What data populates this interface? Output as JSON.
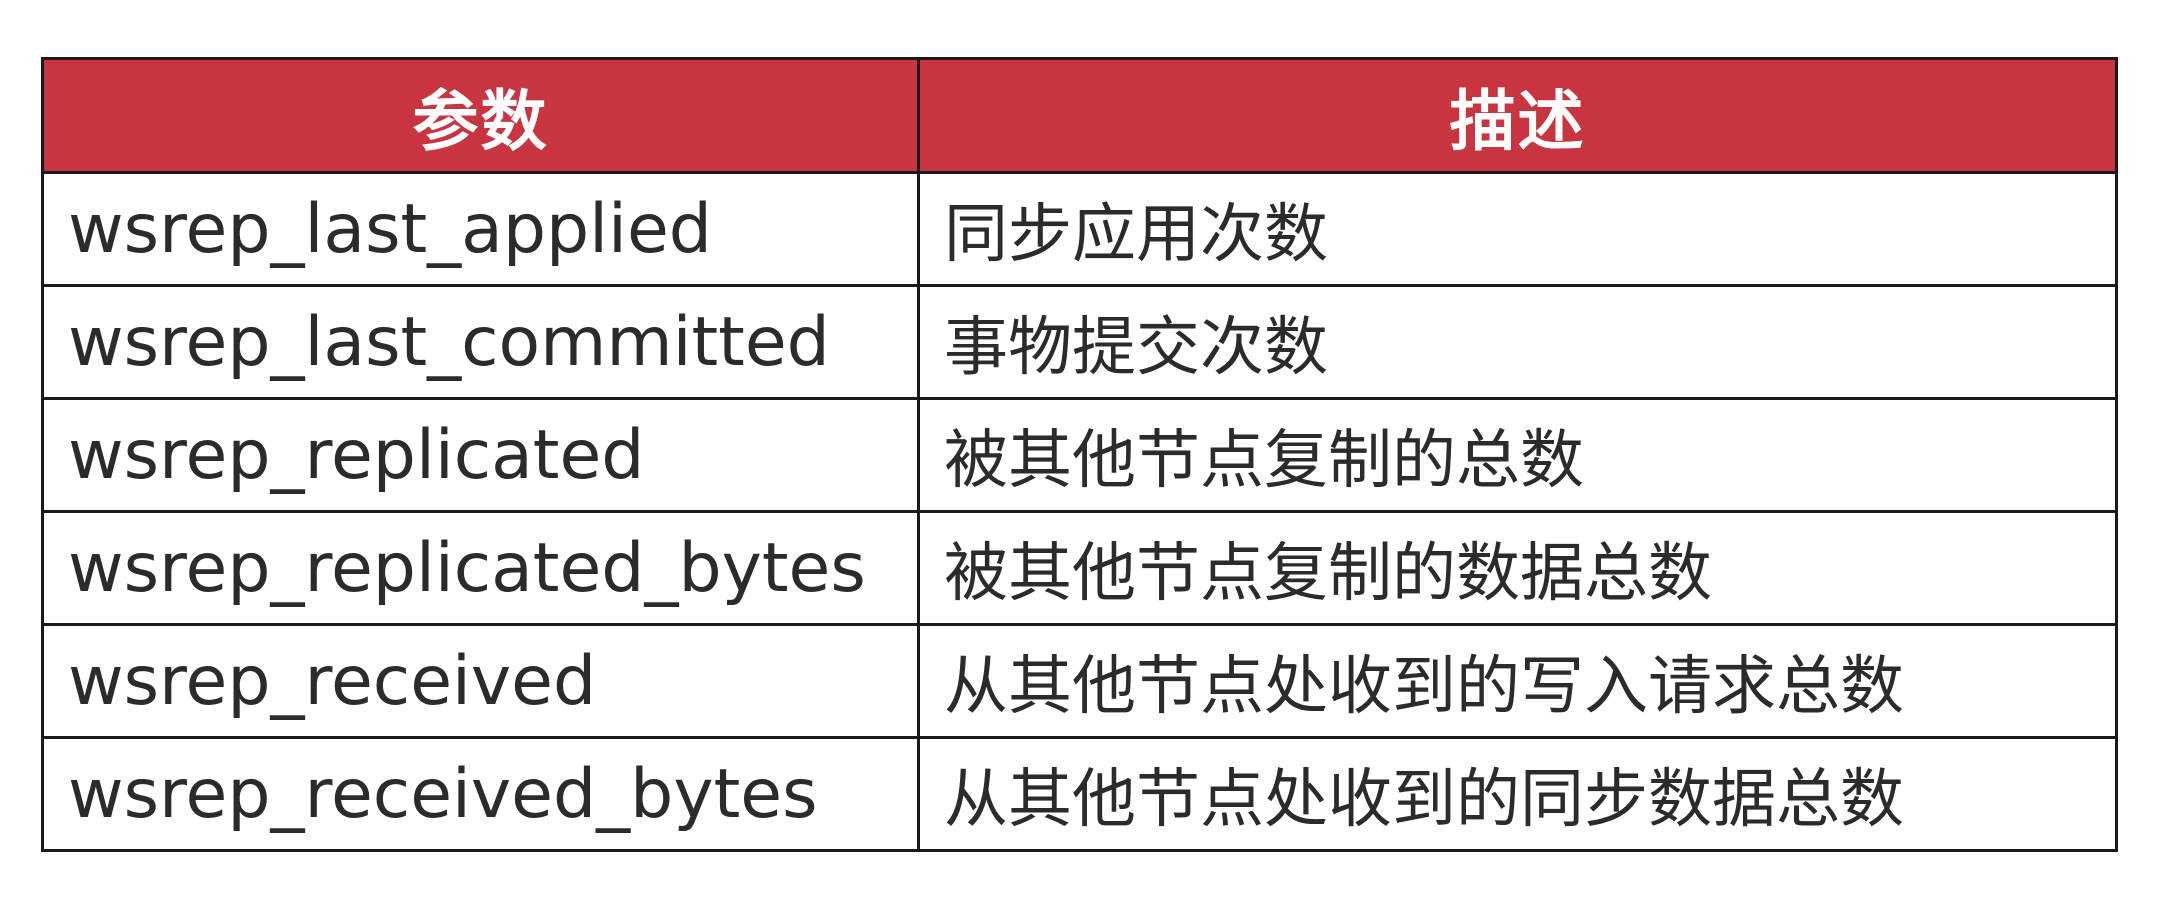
{
  "table": {
    "headers": [
      "参数",
      "描述"
    ],
    "rows": [
      {
        "param": "wsrep_last_applied",
        "desc": "同步应用次数"
      },
      {
        "param": "wsrep_last_committed",
        "desc": "事物提交次数"
      },
      {
        "param": "wsrep_replicated",
        "desc": "被其他节点复制的总数"
      },
      {
        "param": "wsrep_replicated_bytes",
        "desc": "被其他节点复制的数据总数"
      },
      {
        "param": "wsrep_received",
        "desc": "从其他节点处收到的写入请求总数"
      },
      {
        "param": "wsrep_received_bytes",
        "desc": "从其他节点处收到的同步数据总数"
      }
    ]
  },
  "colors": {
    "header_bg": "#c8343f",
    "header_text": "#ffffff",
    "border": "#1a1a1a",
    "cell_text": "#2b2b2b"
  }
}
